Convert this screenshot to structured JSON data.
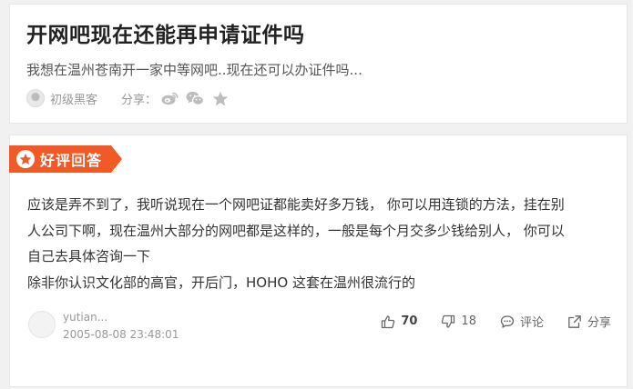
{
  "question": {
    "title": "开网吧现在还能再申请证件吗",
    "description": "我想在温州苍南开一家中等网吧..现在还可以办证件吗...",
    "user": "初级黑客",
    "share_label": "分享："
  },
  "answer": {
    "badge": "好评回答",
    "lines": [
      "应该是弄不到了，我听说现在一个网吧证都能卖好多万钱， 你可以用连锁的方法，挂在别",
      "人公司下啊，现在温州大部分的网吧都是这样的，一般是每个月交多少钱给别人， 你可以",
      "自己去具体咨询一下",
      "除非你认识文化部的高官，开后门，HOHO  这套在温州很流行的"
    ],
    "user": "yutian...",
    "time": "2005-08-08 23:48:01",
    "likes": "70",
    "dislikes": "18",
    "comment_label": "评论",
    "share_label": "分享"
  },
  "icons": {
    "share_targets": [
      "weibo-icon",
      "wechat-icon",
      "star-icon"
    ],
    "accent": "#f05a27"
  }
}
